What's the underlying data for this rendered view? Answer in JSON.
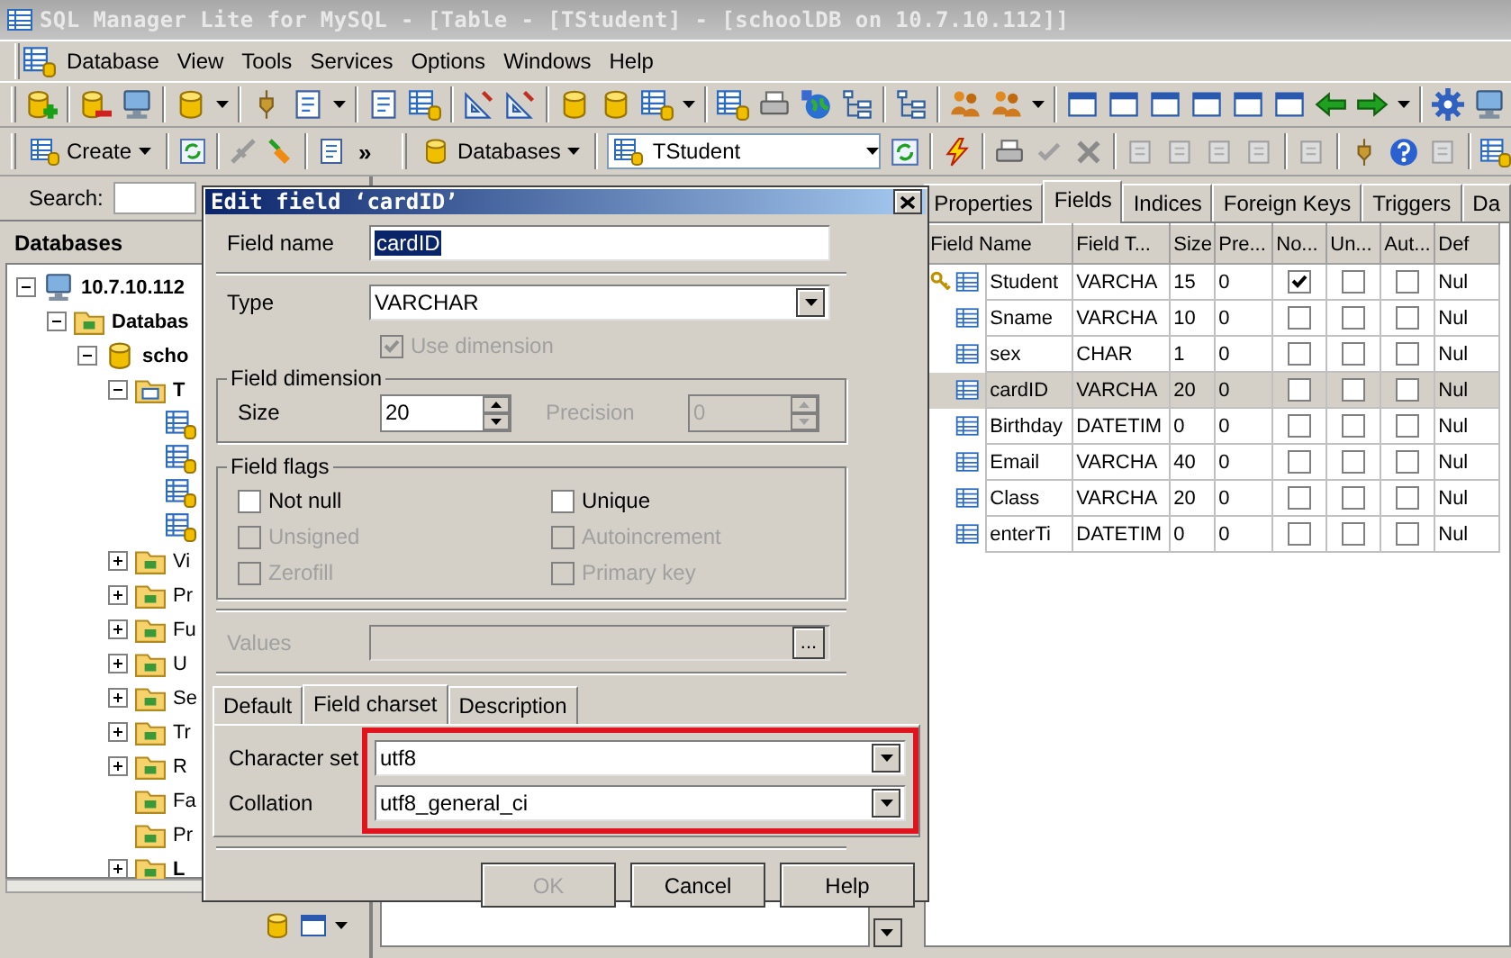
{
  "window": {
    "title": "SQL Manager Lite for MySQL - [Table - [TStudent] - [schoolDB on 10.7.10.112]]"
  },
  "menu": [
    "Database",
    "View",
    "Tools",
    "Services",
    "Options",
    "Windows",
    "Help"
  ],
  "toolbar": {
    "create_button": "Create",
    "chevron": "»",
    "databases_button": "Databases",
    "table_combo": "TStudent"
  },
  "explorer": {
    "search_label": "Search:",
    "header": "Databases",
    "tree": [
      {
        "label": "10.7.10.112",
        "kind": "server",
        "bold": true,
        "expanded": true,
        "children": [
          {
            "label": "Databas",
            "kind": "folder",
            "bold": true,
            "expanded": true,
            "children": [
              {
                "label": "scho",
                "kind": "database",
                "bold": true,
                "expanded": true,
                "children": [
                  {
                    "label": "T",
                    "kind": "tables",
                    "bold": true,
                    "expanded": true,
                    "children": [
                      {
                        "kind": "table"
                      },
                      {
                        "kind": "table"
                      },
                      {
                        "kind": "table"
                      },
                      {
                        "kind": "table"
                      }
                    ]
                  },
                  {
                    "label": "Vi",
                    "kind": "folder",
                    "bold": false,
                    "expanded": false
                  },
                  {
                    "label": "Pr",
                    "kind": "folder",
                    "bold": false,
                    "expanded": false
                  },
                  {
                    "label": "Fu",
                    "kind": "folder",
                    "bold": false,
                    "expanded": false
                  },
                  {
                    "label": "U",
                    "kind": "folder",
                    "bold": false,
                    "expanded": false
                  },
                  {
                    "label": "Se",
                    "kind": "folder",
                    "bold": false,
                    "expanded": false
                  },
                  {
                    "label": "Tr",
                    "kind": "folder",
                    "bold": false,
                    "expanded": false
                  },
                  {
                    "label": "R",
                    "kind": "folder",
                    "bold": false,
                    "expanded": false
                  },
                  {
                    "label": "Fa",
                    "kind": "folder",
                    "bold": false
                  },
                  {
                    "label": "Pr",
                    "kind": "folder",
                    "bold": false
                  },
                  {
                    "label": "L",
                    "kind": "folder",
                    "bold": true,
                    "expanded": false
                  }
                ]
              }
            ]
          }
        ]
      }
    ]
  },
  "dialog": {
    "title": "Edit field ‘cardID’",
    "field_name": {
      "label": "Field name",
      "value": "cardID"
    },
    "type": {
      "label": "Type",
      "value": "VARCHAR"
    },
    "use_dimension": {
      "label": "Use dimension",
      "checked": true,
      "disabled": true
    },
    "dimension": {
      "title": "Field dimension",
      "size": {
        "label": "Size",
        "value": "20",
        "disabled": false
      },
      "precision": {
        "label": "Precision",
        "value": "0",
        "disabled": true
      }
    },
    "flags": {
      "title": "Field flags",
      "items": [
        {
          "label": "Not null",
          "checked": false,
          "disabled": false
        },
        {
          "label": "Unique",
          "checked": false,
          "disabled": false
        },
        {
          "label": "Unsigned",
          "checked": false,
          "disabled": true
        },
        {
          "label": "Autoincrement",
          "checked": false,
          "disabled": true
        },
        {
          "label": "Zerofill",
          "checked": false,
          "disabled": true
        },
        {
          "label": "Primary key",
          "checked": false,
          "disabled": true
        }
      ]
    },
    "values": {
      "label": "Values",
      "disabled": true,
      "button": "..."
    },
    "tabs": [
      {
        "label": "Default",
        "selected": false
      },
      {
        "label": "Field charset",
        "selected": true
      },
      {
        "label": "Description",
        "selected": false
      }
    ],
    "charset": {
      "highlighted": true,
      "character_set": {
        "label": "Character set",
        "value": "utf8"
      },
      "collation": {
        "label": "Collation",
        "value": "utf8_general_ci"
      }
    },
    "buttons": [
      {
        "label": "OK",
        "disabled": true
      },
      {
        "label": "Cancel",
        "disabled": false
      },
      {
        "label": "Help",
        "disabled": false
      }
    ]
  },
  "tabs": [
    {
      "label": "Properties",
      "selected": false
    },
    {
      "label": "Fields",
      "selected": true
    },
    {
      "label": "Indices",
      "selected": false
    },
    {
      "label": "Foreign Keys",
      "selected": false
    },
    {
      "label": "Triggers",
      "selected": false
    },
    {
      "label": "Da",
      "selected": false
    }
  ],
  "fields_grid": {
    "columns": [
      "Field Name",
      "Field T...",
      "Size",
      "Pre...",
      "No...",
      "Un...",
      "Aut...",
      "Def"
    ],
    "rows": [
      {
        "name": "Student",
        "type": "VARCHA",
        "size": "15",
        "precision": "0",
        "not_null": true,
        "unsigned": false,
        "autoincrement": false,
        "default": "Nul",
        "primary_key": true,
        "selected": false
      },
      {
        "name": "Sname",
        "type": "VARCHA",
        "size": "10",
        "precision": "0",
        "not_null": false,
        "unsigned": false,
        "autoincrement": false,
        "default": "Nul",
        "primary_key": false,
        "selected": false
      },
      {
        "name": "sex",
        "type": "CHAR",
        "size": "1",
        "precision": "0",
        "not_null": false,
        "unsigned": false,
        "autoincrement": false,
        "default": "Nul",
        "primary_key": false,
        "selected": false
      },
      {
        "name": "cardID",
        "type": "VARCHA",
        "size": "20",
        "precision": "0",
        "not_null": false,
        "unsigned": false,
        "autoincrement": false,
        "default": "Nul",
        "primary_key": false,
        "selected": true
      },
      {
        "name": "Birthday",
        "type": "DATETIM",
        "size": "0",
        "precision": "0",
        "not_null": false,
        "unsigned": false,
        "autoincrement": false,
        "default": "Nul",
        "primary_key": false,
        "selected": false
      },
      {
        "name": "Email",
        "type": "VARCHA",
        "size": "40",
        "precision": "0",
        "not_null": false,
        "unsigned": false,
        "autoincrement": false,
        "default": "Nul",
        "primary_key": false,
        "selected": false
      },
      {
        "name": "Class",
        "type": "VARCHA",
        "size": "20",
        "precision": "0",
        "not_null": false,
        "unsigned": false,
        "autoincrement": false,
        "default": "Nul",
        "primary_key": false,
        "selected": false
      },
      {
        "name": "enterTi",
        "type": "DATETIM",
        "size": "0",
        "precision": "0",
        "not_null": false,
        "unsigned": false,
        "autoincrement": false,
        "default": "Nul",
        "primary_key": false,
        "selected": false
      }
    ]
  }
}
